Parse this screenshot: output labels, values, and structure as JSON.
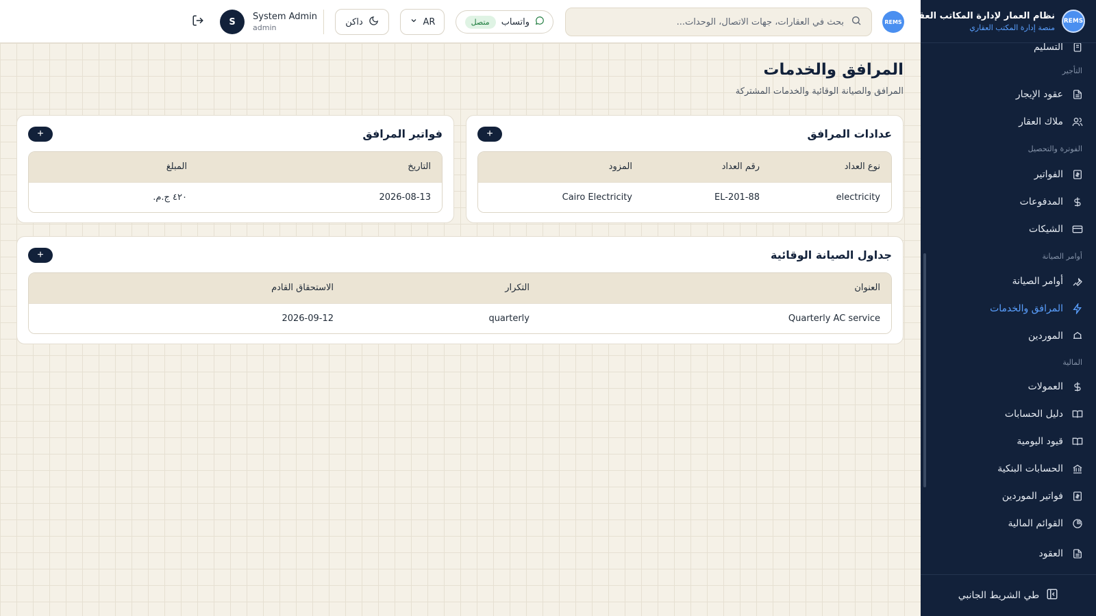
{
  "sidebar": {
    "brand_title": "نظام العمار لإدارة المكاتب العقارية",
    "brand_sub": "منصة إدارة المكتب العقاري",
    "logo_text": "REMS",
    "items": [
      {
        "label": "التسليم",
        "icon": "handover-icon"
      },
      {
        "label": "عقود الإيجار",
        "icon": "file-icon"
      },
      {
        "label": "ملاك العقار",
        "icon": "users-icon"
      },
      {
        "label": "الفواتير",
        "icon": "invoice-icon"
      },
      {
        "label": "المدفوعات",
        "icon": "dollar-icon"
      },
      {
        "label": "الشيكات",
        "icon": "card-icon"
      },
      {
        "label": "أوامر الصيانة",
        "icon": "wrench-icon"
      },
      {
        "label": "المرافق والخدمات",
        "icon": "bolt-icon"
      },
      {
        "label": "الموردين",
        "icon": "truck-icon"
      },
      {
        "label": "العمولات",
        "icon": "dollar-icon"
      },
      {
        "label": "دليل الحسابات",
        "icon": "book-icon"
      },
      {
        "label": "قيود اليومية",
        "icon": "book-icon"
      },
      {
        "label": "الحسابات البنكية",
        "icon": "bank-icon"
      },
      {
        "label": "فواتير الموردين",
        "icon": "invoice-icon"
      },
      {
        "label": "القوائم المالية",
        "icon": "pie-icon"
      },
      {
        "label": "العقود",
        "icon": "file-icon"
      }
    ],
    "sections": [
      "التأجير",
      "الفوترة والتحصيل",
      "أوامر الصيانة",
      "المالية"
    ],
    "collapse_label": "طي الشريط الجانبي"
  },
  "topbar": {
    "search_placeholder": "بحث في العقارات، جهات الاتصال، الوحدات...",
    "whatsapp_label": "واتساب",
    "whatsapp_status": "متصل",
    "lang_label": "AR",
    "theme_label": "داكن",
    "user_initial": "S",
    "user_name": "System Admin",
    "user_role": "admin",
    "logo_text": "REMS"
  },
  "page": {
    "title": "المرافق والخدمات",
    "subtitle": "المرافق والصيانة الوقائية والخدمات المشتركة"
  },
  "meters": {
    "title": "عدادات المرافق",
    "add": "+",
    "headers": [
      "نوع العداد",
      "رقم العداد",
      "المزود"
    ],
    "rows": [
      [
        "electricity",
        "EL-201-88",
        "Cairo Electricity"
      ]
    ]
  },
  "bills": {
    "title": "فواتير المرافق",
    "add": "+",
    "headers": [
      "التاريخ",
      "المبلغ"
    ],
    "rows": [
      [
        "2026-08-13",
        "٤٢٠ ج.م."
      ]
    ]
  },
  "pm": {
    "title": "جداول الصيانة الوقائية",
    "add": "+",
    "headers": [
      "العنوان",
      "التكرار",
      "الاستحقاق القادم"
    ],
    "rows": [
      [
        "Quarterly AC service",
        "quarterly",
        "2026-09-12"
      ]
    ]
  },
  "colors": {
    "sidebar_bg": "#12213a",
    "accent": "#5aa0ff",
    "page_bg": "#f5f1e7",
    "online_badge": "#dff3e4"
  }
}
